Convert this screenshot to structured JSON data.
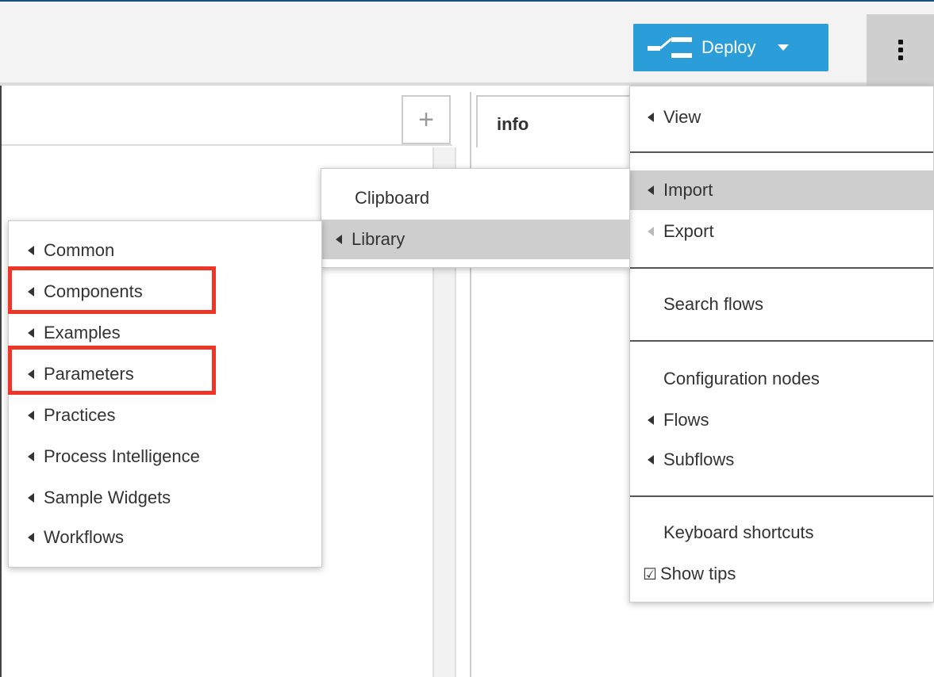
{
  "header": {
    "deploy_label": "Deploy",
    "plus_label": "+",
    "info_tab": "info"
  },
  "main_menu": {
    "items": [
      {
        "label": "View",
        "submenu": true
      },
      {
        "label": "Import",
        "submenu": true,
        "highlighted": true
      },
      {
        "label": "Export",
        "submenu": true,
        "disabled": true
      },
      {
        "label": "Search flows"
      },
      {
        "label": "Configuration nodes"
      },
      {
        "label": "Flows",
        "submenu": true
      },
      {
        "label": "Subflows",
        "submenu": true
      },
      {
        "label": "Keyboard shortcuts"
      },
      {
        "label": "Show tips",
        "checkbox": true,
        "checked": true
      }
    ],
    "checkbox_icon": "☑"
  },
  "import_menu": {
    "items": [
      {
        "label": "Clipboard"
      },
      {
        "label": "Library",
        "submenu": true,
        "highlighted": true
      }
    ]
  },
  "library_menu": {
    "items": [
      {
        "label": "Common"
      },
      {
        "label": "Components"
      },
      {
        "label": "Examples"
      },
      {
        "label": "Parameters"
      },
      {
        "label": "Practices"
      },
      {
        "label": "Process Intelligence"
      },
      {
        "label": "Sample Widgets"
      },
      {
        "label": "Workflows"
      }
    ]
  },
  "colors": {
    "accent": "#2b9ed9",
    "highlight": "#cecece",
    "annotation": "#ef3428"
  },
  "icons": [
    "deploy-icon",
    "caret-down-icon",
    "kebab-menu-icon",
    "plus-icon",
    "caret-left-icon",
    "checkbox-checked-icon"
  ]
}
